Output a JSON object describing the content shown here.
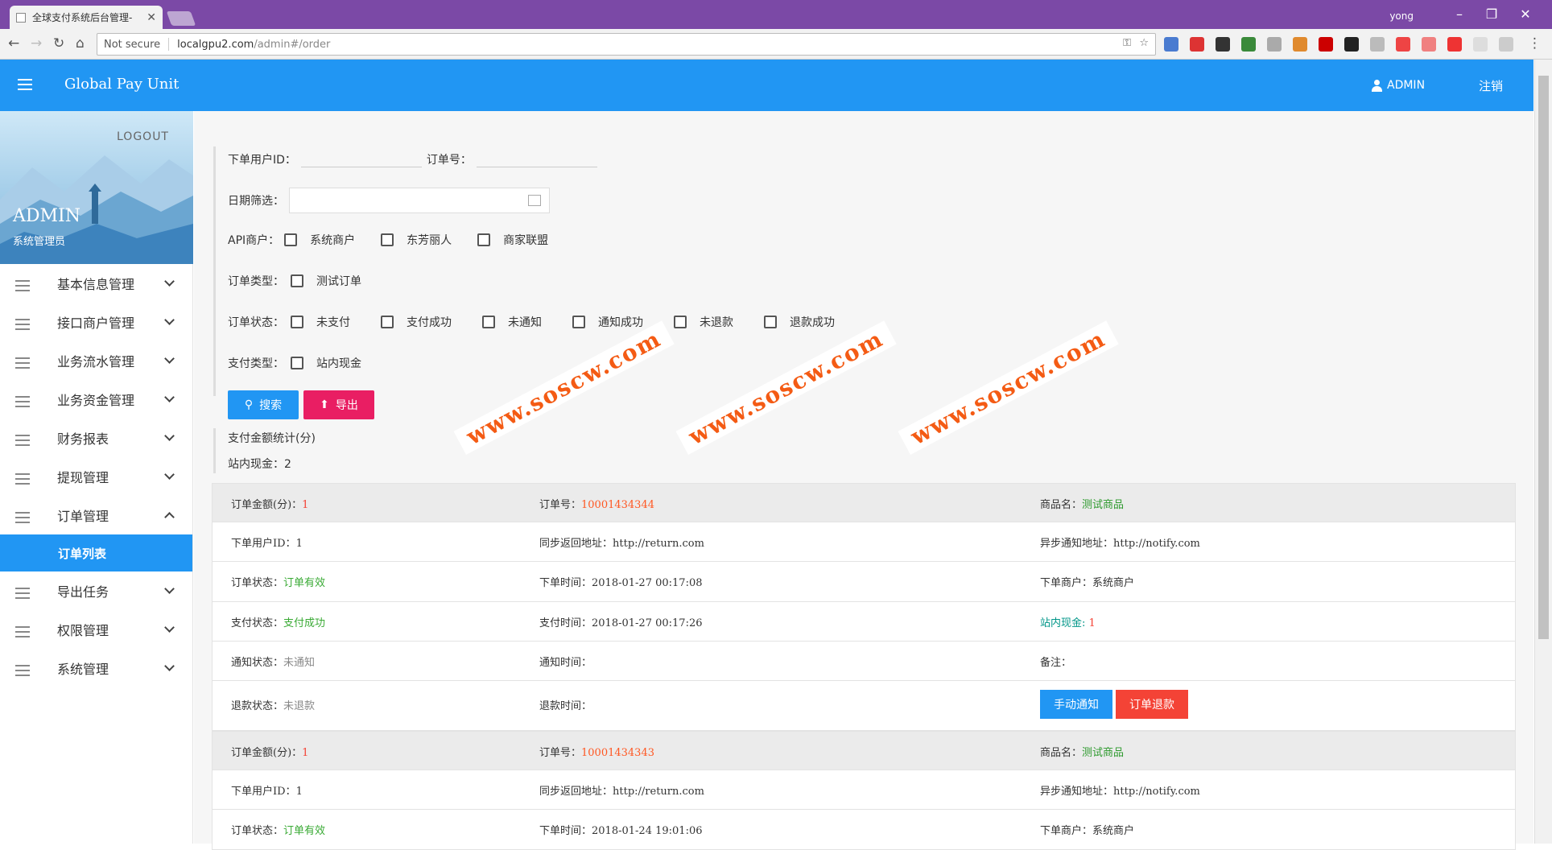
{
  "browser": {
    "tab_title": "全球支付系统后台管理-",
    "user": "yong",
    "security": "Not secure",
    "url_host": "localgpu2.com",
    "url_path": "/admin#/order"
  },
  "topbar": {
    "brand": "Global Pay Unit",
    "admin": "ADMIN",
    "logout": "注销"
  },
  "profile": {
    "logout": "LOGOUT",
    "name": "ADMIN",
    "role": "系统管理员"
  },
  "menu": [
    {
      "label": "基本信息管理"
    },
    {
      "label": "接口商户管理"
    },
    {
      "label": "业务流水管理"
    },
    {
      "label": "业务资金管理"
    },
    {
      "label": "财务报表"
    },
    {
      "label": "提现管理"
    },
    {
      "label": "订单管理"
    },
    {
      "label": "导出任务"
    },
    {
      "label": "权限管理"
    },
    {
      "label": "系统管理"
    }
  ],
  "submenu_active": "订单列表",
  "filter": {
    "user_id_label": "下单用户ID：",
    "order_no_label": "订单号：",
    "date_label": "日期筛选：",
    "api_label": "API商户：",
    "api_options": [
      "系统商户",
      "东芳丽人",
      "商家联盟"
    ],
    "type_label": "订单类型：",
    "type_options": [
      "测试订单"
    ],
    "status_label": "订单状态：",
    "status_options": [
      "未支付",
      "支付成功",
      "未通知",
      "通知成功",
      "未退款",
      "退款成功"
    ],
    "pay_label": "支付类型：",
    "pay_options": [
      "站内现金"
    ],
    "search_btn": "搜索",
    "export_btn": "导出"
  },
  "stats": {
    "title": "支付金额统计(分)",
    "line": "站内现金：2"
  },
  "watermark": "www.soscw.com",
  "orders": [
    {
      "amount_label": "订单金额(分)：",
      "amount": "1",
      "no_label": "订单号：",
      "no": "10001434344",
      "product_label": "商品名：",
      "product": "测试商品",
      "uid_label": "下单用户ID：",
      "uid": "1",
      "sync_label": "同步返回地址：",
      "sync": "http://return.com",
      "async_label": "异步通知地址：",
      "async": "http://notify.com",
      "ostatus_label": "订单状态：",
      "ostatus": "订单有效",
      "otime_label": "下单时间：",
      "otime": "2018-01-27 00:17:08",
      "merchant_label": "下单商户：",
      "merchant": "系统商户",
      "pstatus_label": "支付状态：",
      "pstatus": "支付成功",
      "ptime_label": "支付时间：",
      "ptime": "2018-01-27 00:17:26",
      "cash_label": "站内现金:",
      "cash": "1",
      "nstatus_label": "通知状态：",
      "nstatus": "未通知",
      "ntime_label": "通知时间：",
      "remark_label": "备注：",
      "rstatus_label": "退款状态：",
      "rstatus": "未退款",
      "rtime_label": "退款时间：",
      "notify_btn": "手动通知",
      "refund_btn": "订单退款"
    },
    {
      "amount_label": "订单金额(分)：",
      "amount": "1",
      "no_label": "订单号：",
      "no": "10001434343",
      "product_label": "商品名：",
      "product": "测试商品",
      "uid_label": "下单用户ID：",
      "uid": "1",
      "sync_label": "同步返回地址：",
      "sync": "http://return.com",
      "async_label": "异步通知地址：",
      "async": "http://notify.com",
      "ostatus_label": "订单状态：",
      "ostatus": "订单有效",
      "otime_label": "下单时间：",
      "otime": "2018-01-24 19:01:06",
      "merchant_label": "下单商户：",
      "merchant": "系统商户"
    }
  ],
  "colors": {
    "primary": "#2196f3",
    "titlebar": "#7b49a6",
    "export": "#e91e63",
    "refund": "#f44336"
  }
}
